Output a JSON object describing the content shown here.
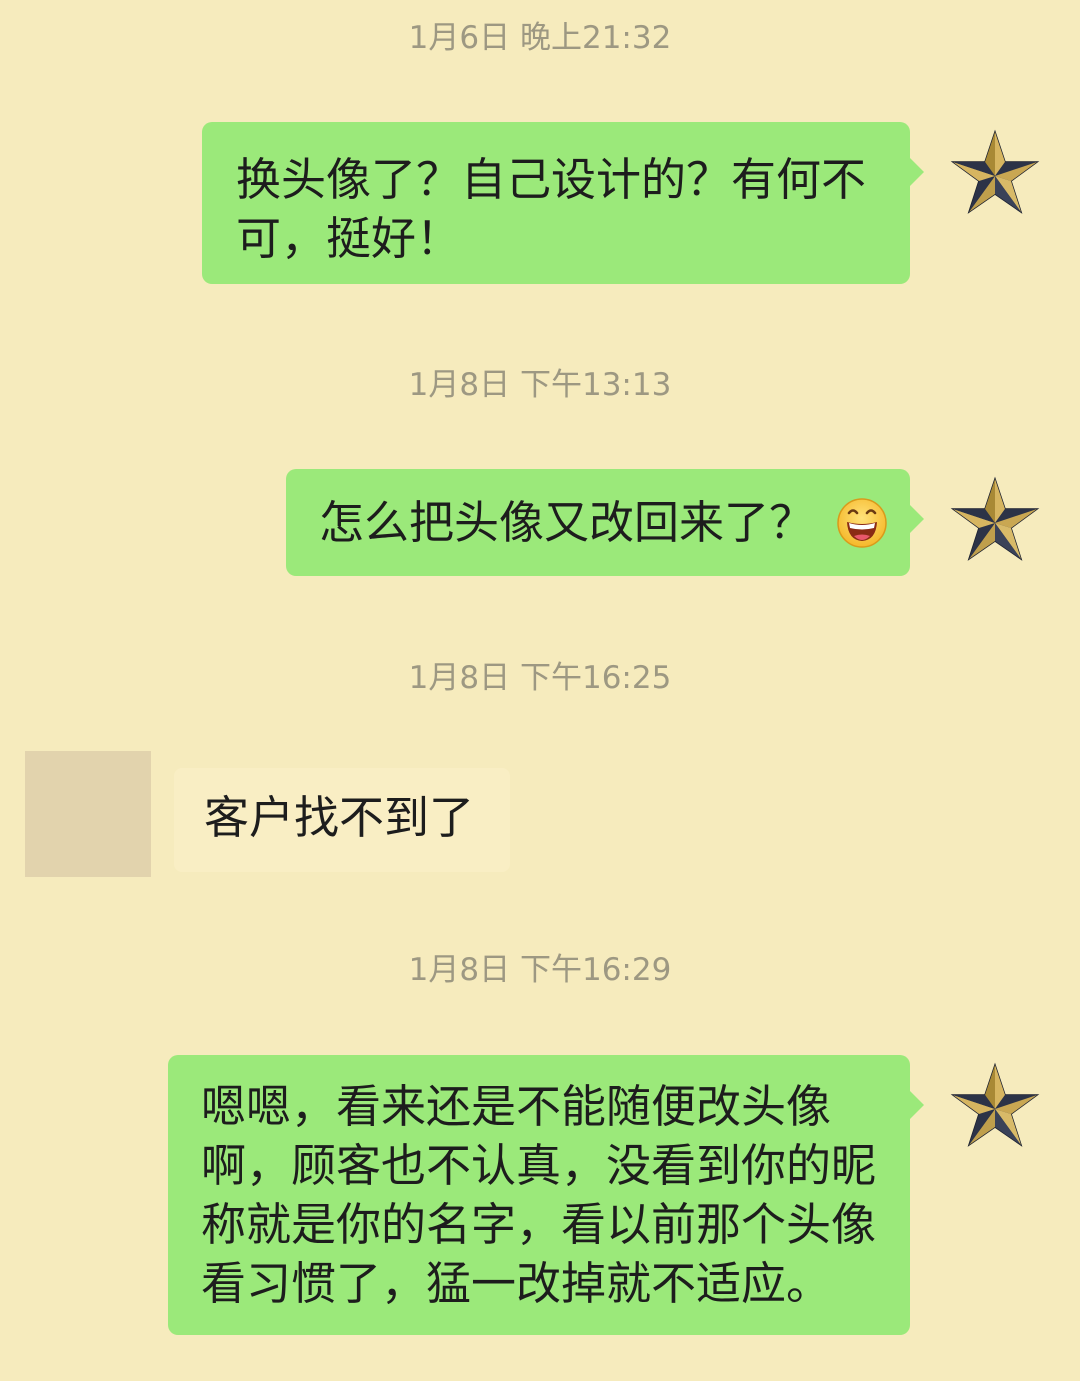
{
  "messages": [
    {
      "time": "1月6日 晚上21:32",
      "sender": "me",
      "text": "换头像了？自己设计的？有何不可，挺好！"
    },
    {
      "time": "1月8日 下午13:13",
      "sender": "me",
      "text": "怎么把头像又改回来了？",
      "emoji": "grinning-face-emoji"
    },
    {
      "time": "1月8日 下午16:25",
      "sender": "other",
      "text": "客户找不到了"
    },
    {
      "time": "1月8日 下午16:29",
      "sender": "me",
      "text": "嗯嗯，看来还是不能随便改头像啊，顾客也不认真，没看到你的昵称就是你的名字，看以前那个头像看习惯了，猛一改掉就不适应。"
    }
  ],
  "avatars": {
    "me": "gold-star-avatar",
    "other": "blurred-avatar"
  },
  "colors": {
    "background": "#f6ebbd",
    "my_bubble": "#9be97a",
    "other_bubble": "#f9eec4",
    "timestamp": "#9d9882"
  }
}
